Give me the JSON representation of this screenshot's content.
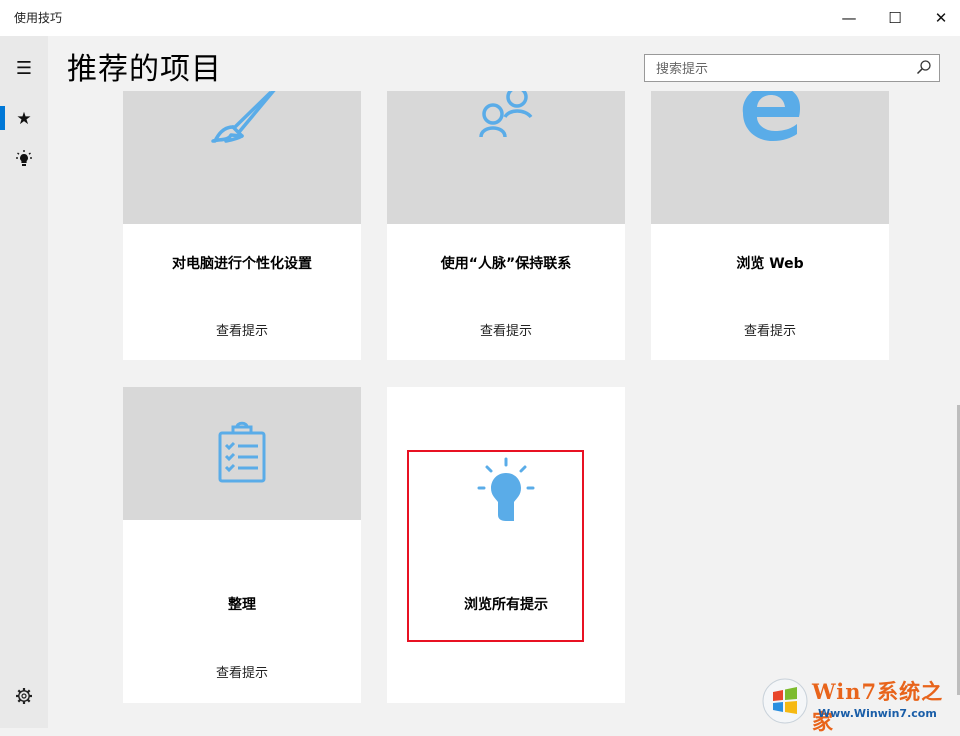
{
  "window": {
    "title": "使用技巧",
    "minimize_glyph": "—",
    "maximize_glyph": "☐",
    "close_glyph": "✕"
  },
  "sidebar": {
    "items": [
      {
        "icon": "hamburger-menu-icon",
        "glyph": "☰"
      },
      {
        "icon": "star-icon",
        "glyph": "★",
        "selected": true
      },
      {
        "icon": "lightbulb-icon",
        "glyph": "💡"
      }
    ],
    "settings_icon": "gear-icon",
    "accent": "#0078d7"
  },
  "header": {
    "title": "推荐的项目",
    "search": {
      "placeholder": "搜索提示",
      "value": ""
    }
  },
  "cards": [
    {
      "title": "对电脑进行个性化设置",
      "link": "查看提示",
      "icon": "paintbrush-icon"
    },
    {
      "title": "使用“人脉”保持联系",
      "link": "查看提示",
      "icon": "people-icon"
    },
    {
      "title": "浏览 Web",
      "link": "查看提示",
      "icon": "edge-icon"
    },
    {
      "title": "整理",
      "link": "查看提示",
      "icon": "clipboard-checklist-icon"
    },
    {
      "title": "浏览所有提示",
      "link": "",
      "icon": "lightbulb-icon",
      "highlighted": true
    }
  ],
  "colors": {
    "icon_blue": "#5aace8",
    "card_header_gray": "#d8d8d8",
    "highlight_red": "#e81123"
  },
  "watermark": {
    "brand": "Win7系统之家",
    "url": "Www.Winwin7.com"
  }
}
